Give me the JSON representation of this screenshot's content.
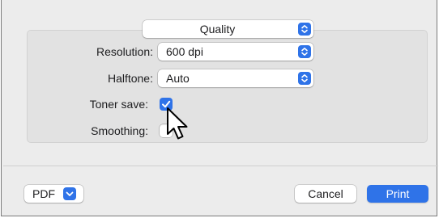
{
  "panel": {
    "selector": "Quality"
  },
  "settings": {
    "resolution": {
      "label": "Resolution:",
      "value": "600 dpi"
    },
    "halftone": {
      "label": "Halftone:",
      "value": "Auto"
    },
    "toner_save": {
      "label": "Toner save:",
      "checked": true
    },
    "smoothing": {
      "label": "Smoothing:",
      "checked": false
    }
  },
  "footer": {
    "pdf_label": "PDF",
    "cancel_label": "Cancel",
    "print_label": "Print"
  },
  "icons": {
    "popup_stepper": "up-down-chevron-icon",
    "pdf_menu": "chevron-down-icon",
    "checkmark": "checkmark-icon",
    "cursor": "mouse-pointer-icon"
  },
  "colors": {
    "accent": "#2f73e8",
    "dialog_bg": "#ececec",
    "group_bg": "#e2e2e2"
  }
}
